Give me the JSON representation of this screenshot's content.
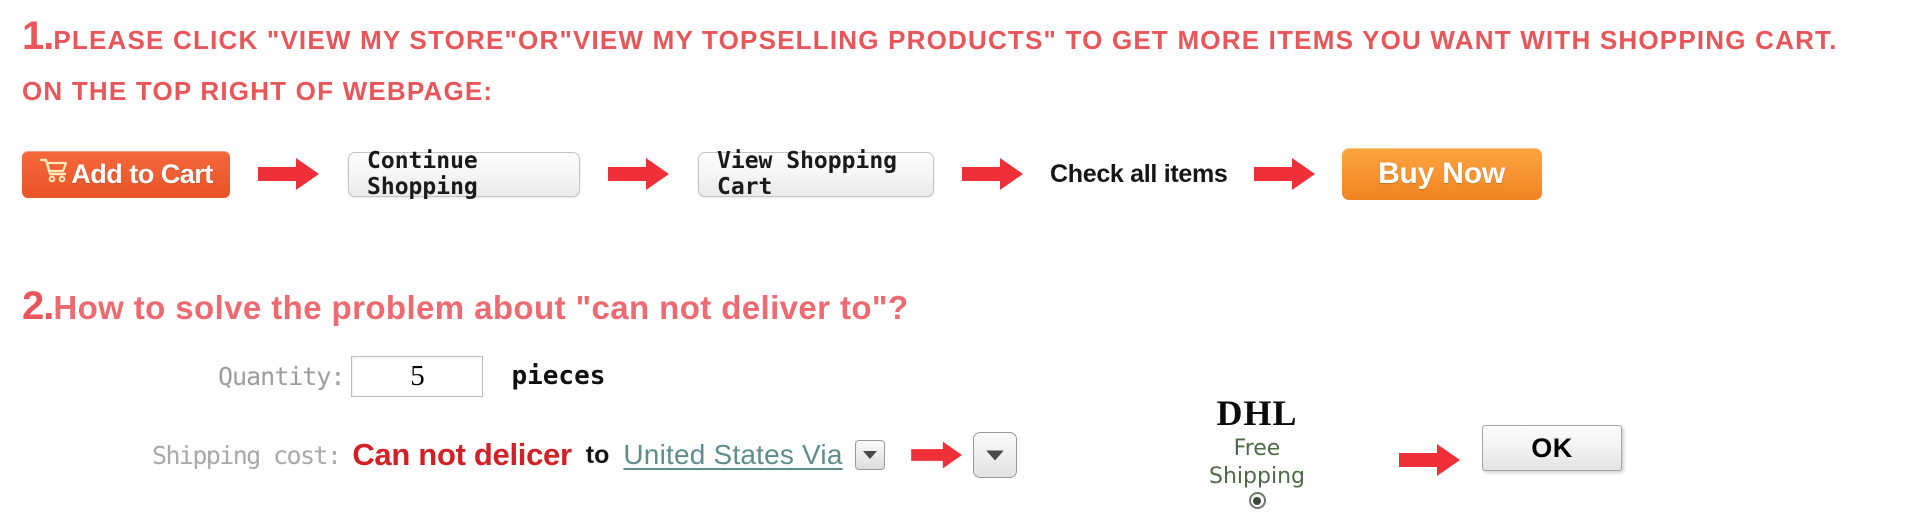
{
  "section1": {
    "number": "1.",
    "line1": "PLEASE CLICK \"VIEW MY STORE\"OR\"VIEW MY TOPSELLING PRODUCTS\" TO GET MORE ITEMS YOU WANT WITH SHOPPING CART.",
    "line2": "ON THE TOP RIGHT OF WEBPAGE:",
    "accent_color": "#e8565a",
    "flow": {
      "add_to_cart_label": "Add to Cart",
      "add_to_cart_icon": "shopping-cart-icon",
      "continue_shopping_label": "Continue Shopping",
      "view_shopping_cart_label": "View Shopping Cart",
      "check_all_items_label": "Check all items",
      "buy_now_label": "Buy Now",
      "arrow_icon": "right-arrow-icon",
      "arrow_color": "#ef3038",
      "add_to_cart_color": "#ef5f33",
      "buy_now_color": "#f79633"
    }
  },
  "section2": {
    "number": "2.",
    "heading": "How to solve the problem about \"can not deliver to\"?",
    "heading_color": "#ef6a70",
    "quantity": {
      "label": "Quantity:",
      "value": "5",
      "placeholder": "5",
      "unit": "pieces"
    },
    "shipping": {
      "label": "Shipping cost:",
      "error": "Can not delicer",
      "to": "to",
      "destination": "United States Via",
      "error_color": "#d31f26",
      "destination_color": "#5e8e8c",
      "country_select_icon": "chevron-down-icon",
      "method_select_icon": "chevron-down-icon"
    },
    "carrier": {
      "name": "DHL",
      "free_line1": "Free",
      "free_line2": "Shipping",
      "free_color": "#4c6b46",
      "radio_icon": "radio-selected-icon",
      "radio_selected": true
    },
    "ok_label": "OK",
    "arrow_icon": "right-arrow-icon"
  }
}
